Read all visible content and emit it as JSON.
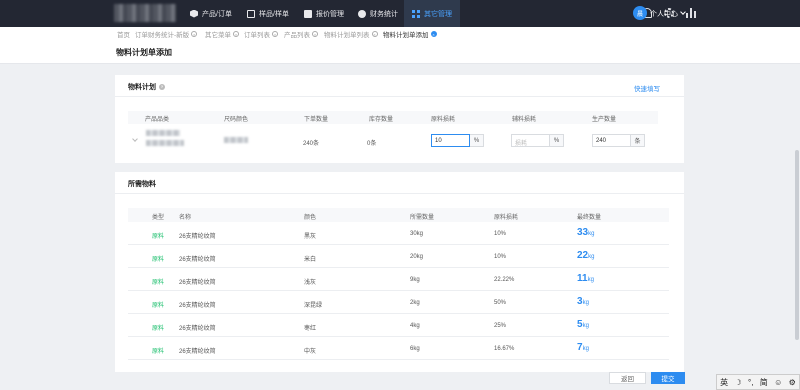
{
  "nav": {
    "items": [
      {
        "label": "产品/订单",
        "icon": "cube-icon"
      },
      {
        "label": "样品/样单",
        "icon": "box-icon"
      },
      {
        "label": "报价管理",
        "icon": "calculator-icon"
      },
      {
        "label": "财务统计",
        "icon": "coin-icon"
      },
      {
        "label": "其它管理",
        "icon": "grid-icon",
        "active": true
      }
    ],
    "user_avatar_text": "晨",
    "user_center": "个人中心"
  },
  "breadcrumb_tabs": [
    "首页",
    "订单财务统计-新版",
    "其它菜单",
    "订单列表",
    "产品列表",
    "物料计划单列表",
    "物料计划单添加"
  ],
  "page_title": "物料计划单添加",
  "plan_card": {
    "title": "物料计划",
    "quick_fill": "快速填写",
    "headers": [
      "产品品类",
      "尺码颜色",
      "下单数量",
      "库存数量",
      "原料损耗",
      "辅料损耗",
      "生产数量"
    ],
    "row": {
      "order_qty": "240条",
      "stock_qty": "0条",
      "raw_loss": "10",
      "raw_loss_unit": "%",
      "aux_loss_placeholder": "损耗",
      "aux_loss_unit": "%",
      "production_qty": "240",
      "production_unit": "条"
    }
  },
  "materials_card": {
    "title": "所需物料",
    "headers": [
      "类型",
      "名称",
      "颜色",
      "所需数量",
      "原料损耗",
      "最终数量"
    ],
    "rows": [
      {
        "type": "原料",
        "name": "26支精纶纹简",
        "color": "黑灰",
        "qty": "30kg",
        "loss": "10%",
        "final": "33",
        "unit": "kg"
      },
      {
        "type": "原料",
        "name": "26支精纶纹简",
        "color": "米白",
        "qty": "20kg",
        "loss": "10%",
        "final": "22",
        "unit": "kg"
      },
      {
        "type": "原料",
        "name": "26支精纶纹简",
        "color": "浅灰",
        "qty": "9kg",
        "loss": "22.22%",
        "final": "11",
        "unit": "kg"
      },
      {
        "type": "原料",
        "name": "26支精纶纹简",
        "color": "深昆绿",
        "qty": "2kg",
        "loss": "50%",
        "final": "3",
        "unit": "kg"
      },
      {
        "type": "原料",
        "name": "26支精纶纹简",
        "color": "枣红",
        "qty": "4kg",
        "loss": "25%",
        "final": "5",
        "unit": "kg"
      },
      {
        "type": "原料",
        "name": "26支精纶纹简",
        "color": "中灰",
        "qty": "6kg",
        "loss": "16.67%",
        "final": "7",
        "unit": "kg"
      }
    ]
  },
  "buttons": {
    "back": "返回",
    "submit": "提交"
  },
  "ime": [
    "英",
    "☽",
    "°,",
    "简",
    "☺",
    "⚙"
  ],
  "colors": {
    "nav_bg": "#232733",
    "accent": "#2d8cf0",
    "material_type": "#19be6b"
  }
}
